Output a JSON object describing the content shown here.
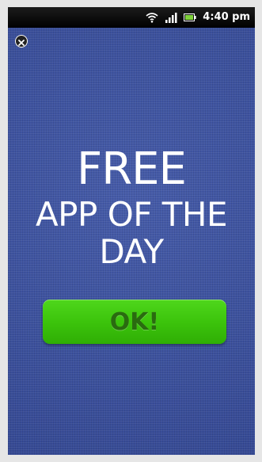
{
  "status_bar": {
    "time": "4:40 pm",
    "icons": [
      "wifi-icon",
      "signal-icon",
      "battery-icon"
    ]
  },
  "close": {
    "icon": "close-icon"
  },
  "headline": {
    "free": "FREE",
    "subtitle": "APP OF THE DAY"
  },
  "ok_button": {
    "label": "OK!",
    "color": "#3cc40c"
  },
  "colors": {
    "background": "#3b519e",
    "status_bar": "#000000",
    "text": "#ffffff"
  }
}
